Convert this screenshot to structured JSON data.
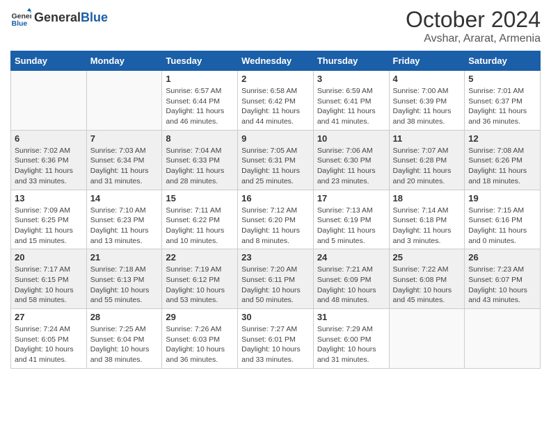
{
  "logo": {
    "text_general": "General",
    "text_blue": "Blue"
  },
  "title": "October 2024",
  "subtitle": "Avshar, Ararat, Armenia",
  "headers": [
    "Sunday",
    "Monday",
    "Tuesday",
    "Wednesday",
    "Thursday",
    "Friday",
    "Saturday"
  ],
  "weeks": [
    [
      {
        "day": "",
        "info": ""
      },
      {
        "day": "",
        "info": ""
      },
      {
        "day": "1",
        "info": "Sunrise: 6:57 AM\nSunset: 6:44 PM\nDaylight: 11 hours and 46 minutes."
      },
      {
        "day": "2",
        "info": "Sunrise: 6:58 AM\nSunset: 6:42 PM\nDaylight: 11 hours and 44 minutes."
      },
      {
        "day": "3",
        "info": "Sunrise: 6:59 AM\nSunset: 6:41 PM\nDaylight: 11 hours and 41 minutes."
      },
      {
        "day": "4",
        "info": "Sunrise: 7:00 AM\nSunset: 6:39 PM\nDaylight: 11 hours and 38 minutes."
      },
      {
        "day": "5",
        "info": "Sunrise: 7:01 AM\nSunset: 6:37 PM\nDaylight: 11 hours and 36 minutes."
      }
    ],
    [
      {
        "day": "6",
        "info": "Sunrise: 7:02 AM\nSunset: 6:36 PM\nDaylight: 11 hours and 33 minutes."
      },
      {
        "day": "7",
        "info": "Sunrise: 7:03 AM\nSunset: 6:34 PM\nDaylight: 11 hours and 31 minutes."
      },
      {
        "day": "8",
        "info": "Sunrise: 7:04 AM\nSunset: 6:33 PM\nDaylight: 11 hours and 28 minutes."
      },
      {
        "day": "9",
        "info": "Sunrise: 7:05 AM\nSunset: 6:31 PM\nDaylight: 11 hours and 25 minutes."
      },
      {
        "day": "10",
        "info": "Sunrise: 7:06 AM\nSunset: 6:30 PM\nDaylight: 11 hours and 23 minutes."
      },
      {
        "day": "11",
        "info": "Sunrise: 7:07 AM\nSunset: 6:28 PM\nDaylight: 11 hours and 20 minutes."
      },
      {
        "day": "12",
        "info": "Sunrise: 7:08 AM\nSunset: 6:26 PM\nDaylight: 11 hours and 18 minutes."
      }
    ],
    [
      {
        "day": "13",
        "info": "Sunrise: 7:09 AM\nSunset: 6:25 PM\nDaylight: 11 hours and 15 minutes."
      },
      {
        "day": "14",
        "info": "Sunrise: 7:10 AM\nSunset: 6:23 PM\nDaylight: 11 hours and 13 minutes."
      },
      {
        "day": "15",
        "info": "Sunrise: 7:11 AM\nSunset: 6:22 PM\nDaylight: 11 hours and 10 minutes."
      },
      {
        "day": "16",
        "info": "Sunrise: 7:12 AM\nSunset: 6:20 PM\nDaylight: 11 hours and 8 minutes."
      },
      {
        "day": "17",
        "info": "Sunrise: 7:13 AM\nSunset: 6:19 PM\nDaylight: 11 hours and 5 minutes."
      },
      {
        "day": "18",
        "info": "Sunrise: 7:14 AM\nSunset: 6:18 PM\nDaylight: 11 hours and 3 minutes."
      },
      {
        "day": "19",
        "info": "Sunrise: 7:15 AM\nSunset: 6:16 PM\nDaylight: 11 hours and 0 minutes."
      }
    ],
    [
      {
        "day": "20",
        "info": "Sunrise: 7:17 AM\nSunset: 6:15 PM\nDaylight: 10 hours and 58 minutes."
      },
      {
        "day": "21",
        "info": "Sunrise: 7:18 AM\nSunset: 6:13 PM\nDaylight: 10 hours and 55 minutes."
      },
      {
        "day": "22",
        "info": "Sunrise: 7:19 AM\nSunset: 6:12 PM\nDaylight: 10 hours and 53 minutes."
      },
      {
        "day": "23",
        "info": "Sunrise: 7:20 AM\nSunset: 6:11 PM\nDaylight: 10 hours and 50 minutes."
      },
      {
        "day": "24",
        "info": "Sunrise: 7:21 AM\nSunset: 6:09 PM\nDaylight: 10 hours and 48 minutes."
      },
      {
        "day": "25",
        "info": "Sunrise: 7:22 AM\nSunset: 6:08 PM\nDaylight: 10 hours and 45 minutes."
      },
      {
        "day": "26",
        "info": "Sunrise: 7:23 AM\nSunset: 6:07 PM\nDaylight: 10 hours and 43 minutes."
      }
    ],
    [
      {
        "day": "27",
        "info": "Sunrise: 7:24 AM\nSunset: 6:05 PM\nDaylight: 10 hours and 41 minutes."
      },
      {
        "day": "28",
        "info": "Sunrise: 7:25 AM\nSunset: 6:04 PM\nDaylight: 10 hours and 38 minutes."
      },
      {
        "day": "29",
        "info": "Sunrise: 7:26 AM\nSunset: 6:03 PM\nDaylight: 10 hours and 36 minutes."
      },
      {
        "day": "30",
        "info": "Sunrise: 7:27 AM\nSunset: 6:01 PM\nDaylight: 10 hours and 33 minutes."
      },
      {
        "day": "31",
        "info": "Sunrise: 7:29 AM\nSunset: 6:00 PM\nDaylight: 10 hours and 31 minutes."
      },
      {
        "day": "",
        "info": ""
      },
      {
        "day": "",
        "info": ""
      }
    ]
  ]
}
